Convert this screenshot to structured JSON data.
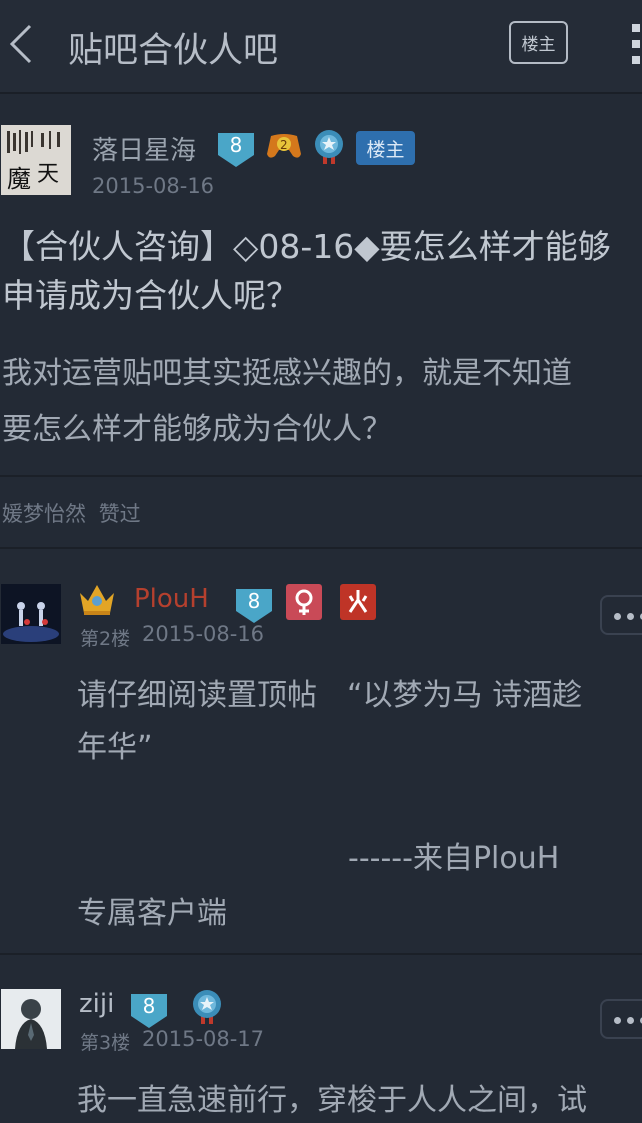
{
  "header": {
    "title": "贴吧合伙人吧",
    "owner_only_label": "楼主"
  },
  "op": {
    "username": "落日星海",
    "level": "8",
    "owner_tag": "楼主",
    "date": "2015-08-16",
    "title_line1": "【合伙人咨询】◇08-16◆要怎么样才能够",
    "title_line2": "申请成为合伙人呢？",
    "body_line1": "我对运营贴吧其实挺感兴趣的，就是不知道",
    "body_line2": "要怎么样才能够成为合伙人？",
    "liked_by": "媛梦怡然",
    "liked_suffix": "赞过"
  },
  "replies": [
    {
      "username": "PlouH",
      "level": "8",
      "floor": "第2楼",
      "date": "2015-08-16",
      "line1": "请仔细阅读置顶帖　“以梦为马 诗酒趁",
      "line2": "年华”",
      "line3": "------来自PlouH",
      "line4": "专属客户端"
    },
    {
      "username": "ziji",
      "level": "8",
      "floor": "第3楼",
      "date": "2015-08-17",
      "line1": "我一直急速前行，穿梭于人人之间，试"
    }
  ],
  "colors": {
    "background": "#232a35",
    "accent_blue": "#4aa6c8",
    "vip_red": "#b5402e",
    "owner_tag_blue": "#2e6fae"
  }
}
